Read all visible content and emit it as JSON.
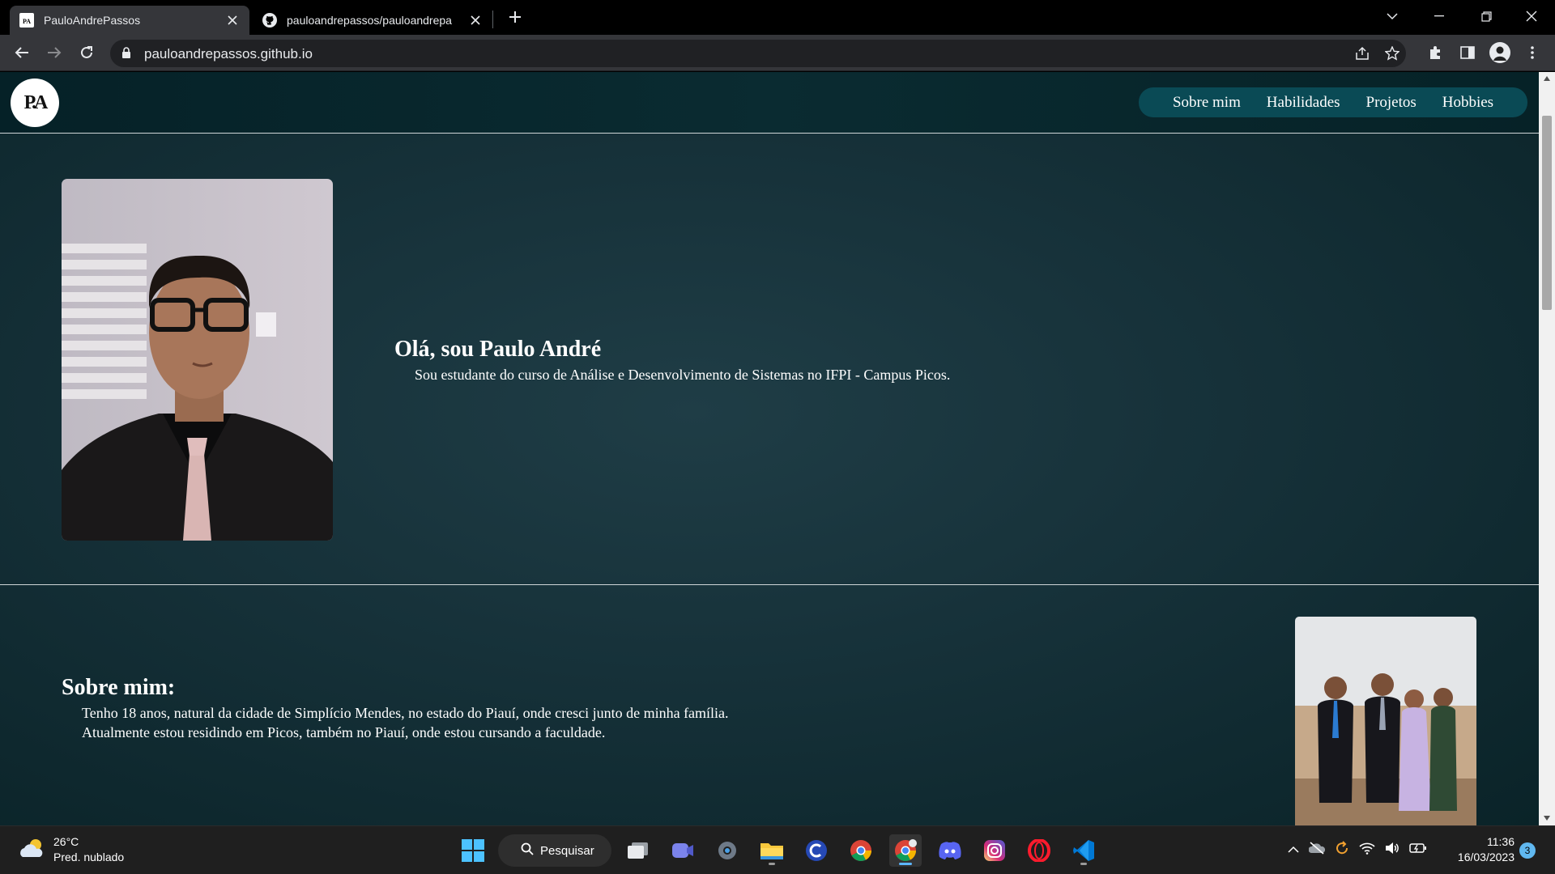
{
  "browser": {
    "tabs": [
      {
        "title": "PauloAndrePassos",
        "active": true,
        "favicon": "pa-logo-icon"
      },
      {
        "title": "pauloandrepassos/pauloandrepa",
        "active": false,
        "favicon": "github-icon"
      }
    ],
    "url": "pauloandrepassos.github.io"
  },
  "site": {
    "logo_text": "P.A",
    "nav": [
      "Sobre mim",
      "Habilidades",
      "Projetos",
      "Hobbies"
    ],
    "hero": {
      "title": "Olá, sou Paulo André",
      "description": "Sou estudante do curso de Análise e Desenvolvimento de Sistemas no IFPI - Campus Picos."
    },
    "about": {
      "title": "Sobre mim:",
      "lines": [
        "Tenho 18 anos, natural da cidade de Simplício Mendes, no estado do Piauí, onde cresci junto de minha família.",
        "Atualmente estou residindo em Picos, também no Piauí, onde estou cursando a faculdade."
      ]
    }
  },
  "taskbar": {
    "weather": {
      "temp": "26°C",
      "desc": "Pred. nublado"
    },
    "search_label": "Pesquisar",
    "apps": [
      "windows-start-icon",
      "task-view-icon",
      "teams-icon",
      "settings-icon",
      "file-explorer-icon",
      "copilot-icon",
      "chrome-icon",
      "chrome-profile-icon",
      "discord-icon",
      "instagram-icon",
      "opera-icon",
      "vscode-icon"
    ],
    "time": "11:36",
    "date": "16/03/2023",
    "notifications": "3"
  },
  "colors": {
    "page_bg": "#163139",
    "header_bg": "#052127",
    "nav_bg": "#0a4a55",
    "browser_frame": "#000000",
    "toolbar": "#35363a"
  }
}
